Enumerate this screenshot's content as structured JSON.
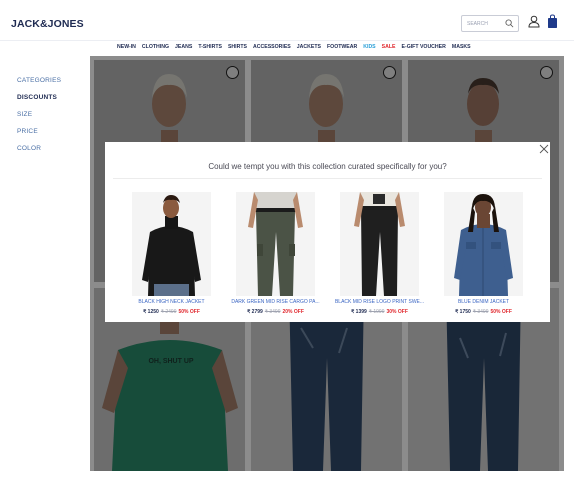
{
  "brand": {
    "logo": "JACK&JONES"
  },
  "header": {
    "search_placeholder": "SEARCH",
    "search_icon": "search-icon",
    "user_icon": "user-icon",
    "bag_icon": "shopping-bag-icon"
  },
  "nav": {
    "items": [
      "NEW-IN",
      "CLOTHING",
      "JEANS",
      "T-SHIRTS",
      "SHIRTS",
      "ACCESSORIES",
      "JACKETS",
      "FOOTWEAR",
      "KIDS",
      "SALE",
      "E-GIFT VOUCHER",
      "MASKS"
    ]
  },
  "sidebar": {
    "items": [
      "CATEGORIES",
      "DISCOUNTS",
      "SIZE",
      "PRICE",
      "COLOR"
    ],
    "active": "DISCOUNTS"
  },
  "modal": {
    "title": "Could we tempt you with this collection curated specifically for you?",
    "close_icon": "close-icon",
    "products": [
      {
        "name": "BLACK HIGH NECK JACKET",
        "price": "₹ 1250",
        "mrp": "₹ 2499",
        "discount": "50% OFF"
      },
      {
        "name": "DARK GREEN MID RISE CARGO PA...",
        "price": "₹ 2799",
        "mrp": "₹ 3499",
        "discount": "20% OFF"
      },
      {
        "name": "BLACK MID RISE LOGO PRINT SWE...",
        "price": "₹ 1399",
        "mrp": "₹ 1999",
        "discount": "30% OFF"
      },
      {
        "name": "BLUE DENIM JACKET",
        "price": "₹ 1750",
        "mrp": "₹ 3499",
        "discount": "50% OFF"
      }
    ]
  },
  "background_grid": {
    "tshirt_print": "OH, SHUT UP"
  },
  "colors": {
    "brand_navy": "#1f2b52",
    "kids": "#2a9fd8",
    "sale": "#e0262c",
    "product_link": "#3b66c3"
  }
}
